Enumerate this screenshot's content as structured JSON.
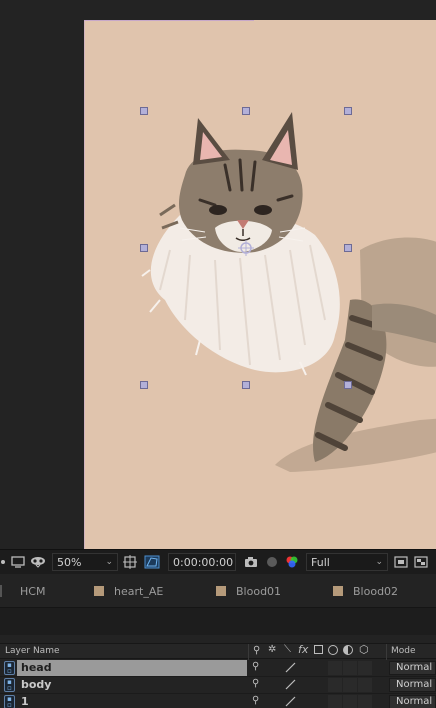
{
  "viewer": {
    "toolbar": {
      "zoom": "50%",
      "timecode": "0:00:00:00",
      "resolution": "Full"
    }
  },
  "tabs": [
    {
      "label": "HCM",
      "has_swatch": false
    },
    {
      "label": "heart_AE",
      "has_swatch": true
    },
    {
      "label": "Blood01",
      "has_swatch": true
    },
    {
      "label": "Blood02",
      "has_swatch": true
    }
  ],
  "layers": {
    "header": {
      "name_col": "Layer Name",
      "mode_col": "Mode"
    },
    "rows": [
      {
        "name": "head",
        "mode": "Normal",
        "selected": true
      },
      {
        "name": "body",
        "mode": "Normal",
        "selected": false
      },
      {
        "name": "1",
        "mode": "Normal",
        "selected": false
      }
    ]
  },
  "colors": {
    "canvas_bg": "#e0c4ad",
    "panel_bg": "#232323",
    "selection": "#9a9a9a",
    "handle": "#b3b0d8"
  }
}
